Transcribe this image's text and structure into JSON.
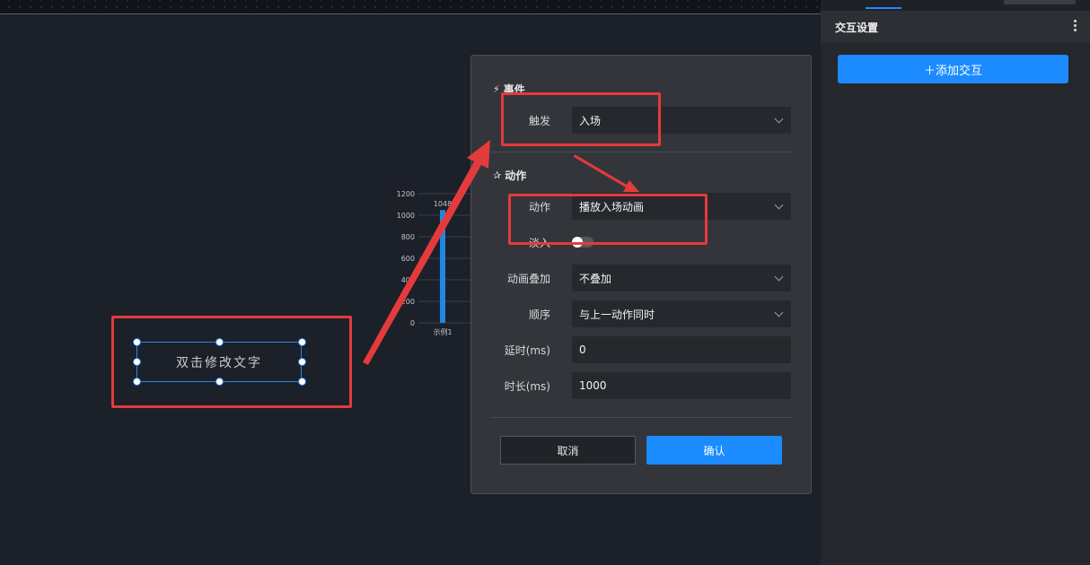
{
  "canvas": {
    "text_widget": "双击修改文字"
  },
  "chart_data": {
    "type": "bar",
    "categories": [
      "示例1"
    ],
    "values": [
      1048
    ],
    "data_labels": [
      "1048"
    ],
    "yticks": [
      "0",
      "200",
      "400",
      "600",
      "800",
      "1000",
      "1200"
    ],
    "ylim": [
      0,
      1200
    ],
    "color": "#1e88e5"
  },
  "dialog": {
    "event_section": "事件",
    "trigger_label": "触发",
    "trigger_value": "入场",
    "action_section": "动作",
    "action_label": "动作",
    "action_value": "播放入场动画",
    "fade_label": "淡入",
    "overlay_label": "动画叠加",
    "overlay_value": "不叠加",
    "order_label": "顺序",
    "order_value": "与上一动作同时",
    "delay_label": "延时(ms)",
    "delay_value": "0",
    "duration_label": "时长(ms)",
    "duration_value": "1000",
    "cancel": "取消",
    "confirm": "确认"
  },
  "panel": {
    "title": "交互设置",
    "add_button": "＋添加交互"
  },
  "colors": {
    "accent": "#1b8bff",
    "annotation": "#e33b3b"
  }
}
